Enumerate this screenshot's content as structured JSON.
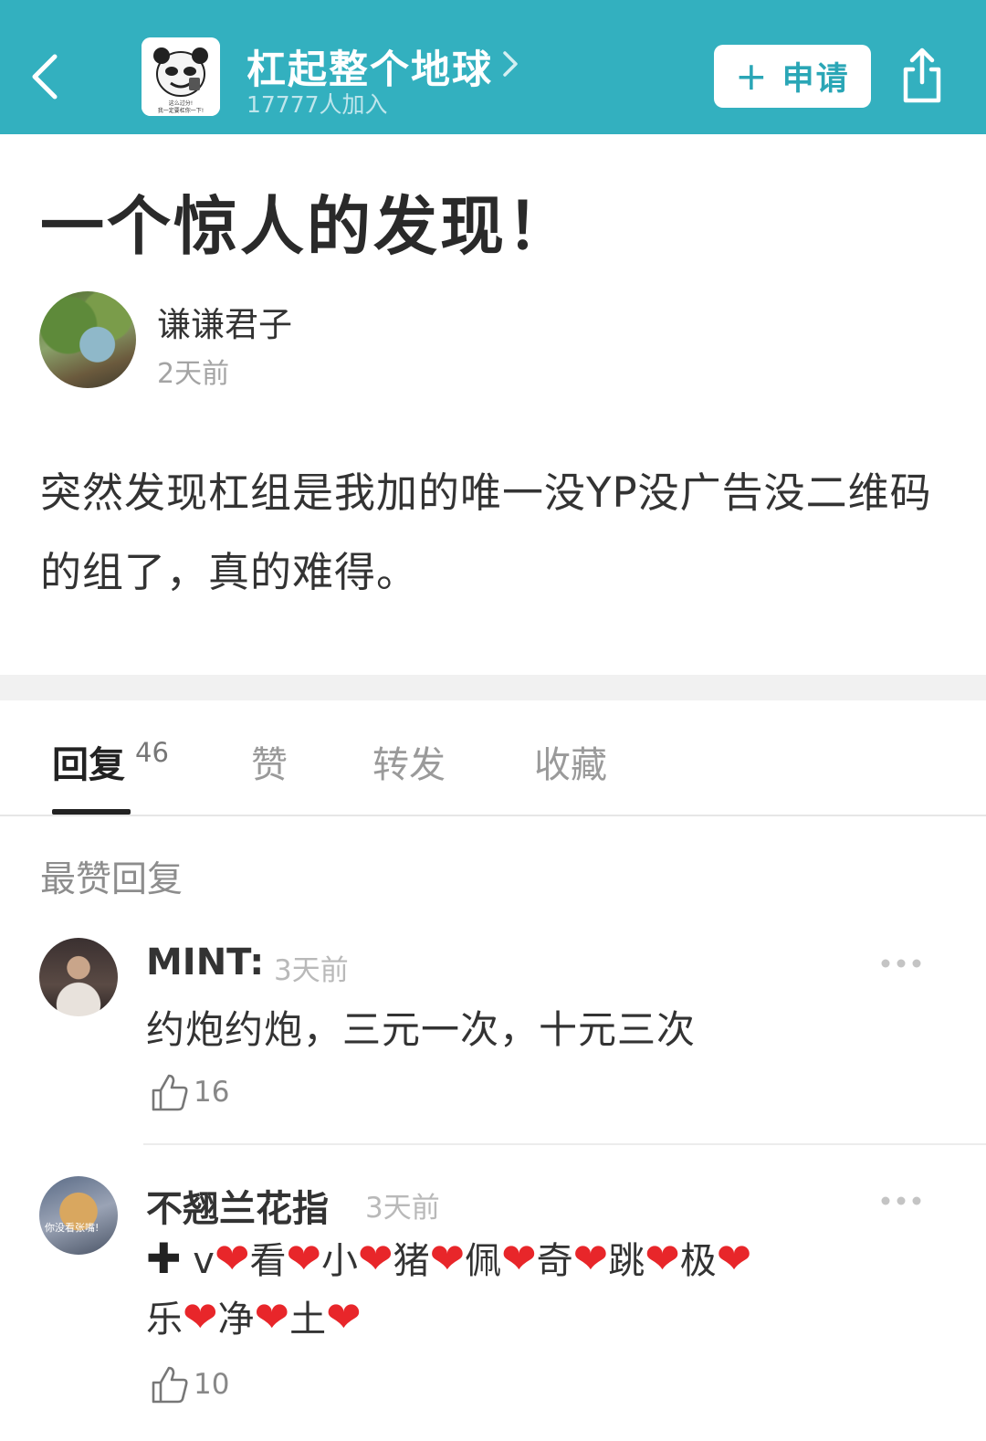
{
  "header": {
    "group_name": "杠起整个地球",
    "member_count": "17777人加入",
    "apply_label": "＋ 申请",
    "group_avatar_caption_1": "这么过分!",
    "group_avatar_caption_2": "我一定要杠你一下!",
    "icons": {
      "back": "chevron-left-icon",
      "share": "share-icon",
      "chevron": "chevron-right-icon"
    },
    "bar_color": "#33b0bf"
  },
  "post": {
    "title": "一个惊人的发现！",
    "author": "谦谦君子",
    "time": "2天前",
    "body": "突然发现杠组是我加的唯一没YP没广告没二维码的组了，真的难得。"
  },
  "tabs": {
    "items": [
      {
        "label": "回复",
        "count": "46",
        "active": true
      },
      {
        "label": "赞"
      },
      {
        "label": "转发"
      },
      {
        "label": "收藏"
      }
    ]
  },
  "section": {
    "label": "最赞回复"
  },
  "comments": [
    {
      "author": "MINT:",
      "time": "3天前",
      "text": "约炮约炮，三元一次，十元三次",
      "likes": "16"
    },
    {
      "author": "不翘兰花指",
      "time": "3天前",
      "avatar_caption": "你没看张嘴!",
      "text_segments": [
        "v",
        "看",
        "小",
        "猪",
        "佩",
        "奇",
        "跳",
        "极",
        "乐",
        "净",
        "土"
      ],
      "likes": "10"
    }
  ]
}
